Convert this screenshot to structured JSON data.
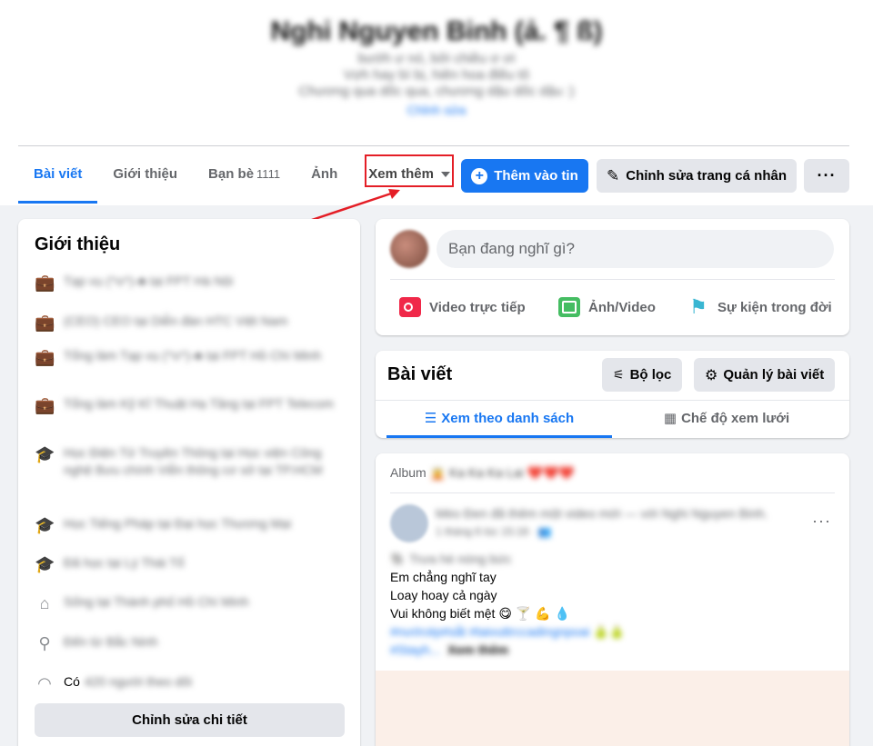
{
  "profile": {
    "name": "Nghi Nguyen Binh (ả. ¶ ß)",
    "bio_lines": [
      "bướh ư nó, bởi chiều ơ ơi",
      "Vợh hay bì bị, hiên hoa điều tô",
      "Chương qua dốc qua, chương dậu dốc dậu :)"
    ],
    "bio_edit": "Chỉnh sửa"
  },
  "tabs": [
    {
      "label": "Bài viết",
      "active": true
    },
    {
      "label": "Giới thiệu",
      "active": false
    },
    {
      "label": "Bạn bè",
      "count": "1111",
      "active": false
    },
    {
      "label": "Ảnh",
      "active": false
    }
  ],
  "more_tab": "Xem thêm",
  "actions": {
    "add_story": "Thêm vào tin",
    "edit_profile": "Chỉnh sửa trang cá nhân",
    "more": "···"
  },
  "intro": {
    "title": "Giới thiệu",
    "items": [
      {
        "icon": "briefcase-icon",
        "text": "Tạp vụ (^o^)-♣ tại FPT Hà Nội"
      },
      {
        "icon": "briefcase-icon",
        "text": "(CEO) CEO tại Diễn đàn HTC Việt Nam"
      },
      {
        "icon": "briefcase-icon",
        "text": "Tổng làm Tạp vụ (^o^)-♣ tại FPT Hồ Chí Minh"
      },
      {
        "icon": "briefcase-icon",
        "text": "Tổng làm Kỹ Kĩ Thuật Hạ Tầng tại FPT Telecom"
      },
      {
        "icon": "graduation-cap-icon",
        "text": "Học Điện Tử Truyền Thông tại Học viện Công nghệ Bưu chính Viễn thông cơ sở tại TP.HCM"
      },
      {
        "icon": "graduation-cap-icon",
        "text": "Học Tiếng Pháp tại Đại học Thương Mại"
      },
      {
        "icon": "graduation-cap-icon",
        "text": "Đã học tại Lý Thái Tổ"
      },
      {
        "icon": "home-icon",
        "text": "Sống tại Thành phố Hồ Chí Minh"
      },
      {
        "icon": "location-pin-icon",
        "text": "Đến từ Bắc Ninh"
      }
    ],
    "followers_prefix": "Có",
    "followers_text": "420 người theo dõi",
    "edit_details": "Chỉnh sửa chi tiết"
  },
  "composer": {
    "placeholder": "Bạn đang nghĩ gì?",
    "actions": [
      "Video trực tiếp",
      "Ảnh/Video",
      "Sự kiện trong đời"
    ]
  },
  "posts": {
    "title": "Bài viết",
    "filter": "Bộ lọc",
    "manage": "Quản lý bài viết",
    "list_view": "Xem theo danh sách",
    "grid_view": "Chế độ xem lưới"
  },
  "post": {
    "album_label": "Album",
    "album_name": "🧝 Ka Ka Ka Lai ❤️❤️❤️",
    "author": "Mèo Đen đã thêm một video mới — với Nghi Nguyen Binh.",
    "time": "1 tháng 6 lúc 15:18 · 👥",
    "lines": [
      "🐘 Trưa hè nóng bức",
      "Em chẳng nghĩ tay",
      "Loay hoay cả ngày",
      "Vui không biết mệt 😋 🍸 💪 💧"
    ],
    "tags": "#nướcép#sắt #taivuttrccadingnpoai 🍐🍐",
    "tags2": "#Stayh...",
    "see_more": "Xem thêm"
  },
  "colors": {
    "accent": "#1877f2",
    "highlight": "#e41e26",
    "background": "#f0f2f5"
  }
}
